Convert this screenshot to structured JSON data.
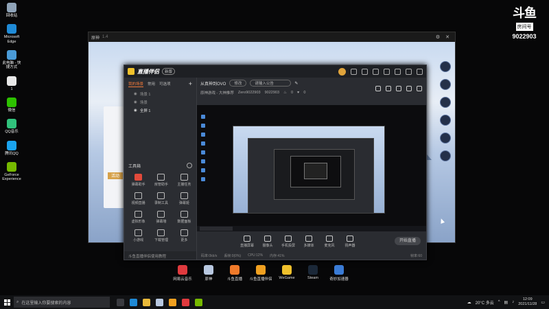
{
  "desktop_icons": [
    {
      "label": "回收站",
      "icon": "recycle-bin-icon",
      "color": "#8fa3b8"
    },
    {
      "label": "Microsoft Edge",
      "icon": "edge-icon",
      "color": "#1f8ad6"
    },
    {
      "label": "此电脑 - 快捷方式",
      "icon": "computer-icon",
      "color": "#4a9bd8"
    },
    {
      "label": "1",
      "icon": "file-icon",
      "color": "#e8e8e8"
    },
    {
      "label": "微信",
      "icon": "wechat-icon",
      "color": "#2dc100"
    },
    {
      "label": "QQ音乐",
      "icon": "qq-music-icon",
      "color": "#31c27c"
    },
    {
      "label": "腾讯QQ",
      "icon": "qq-icon",
      "color": "#1aa3ee"
    },
    {
      "label": "GeForce Experience",
      "icon": "geforce-icon",
      "color": "#76b900"
    }
  ],
  "watermark": {
    "logo": "斗鱼",
    "sub": "房间号",
    "room": "9022903"
  },
  "game_window": {
    "title": "原神",
    "version": "1.4"
  },
  "app": {
    "brand": "直播伴侣",
    "version_badge": "新版",
    "room_name": "从真神到OVO",
    "edit_label": "修改",
    "announce_placeholder": "请输入公告",
    "category": "原神游戏 - 大神推荐",
    "user": "Zero9022903",
    "room_id": "9022903",
    "fire_count": "0",
    "fans_count": "0",
    "tabs": [
      "我的场景",
      "常用",
      "可选项"
    ],
    "scenes": [
      "场景 1",
      "场景",
      "全屏 1"
    ],
    "tools_title": "工具箱",
    "tools": [
      {
        "label": "弹幕助手",
        "red": true
      },
      {
        "label": "房管助手",
        "red": false
      },
      {
        "label": "主播任务",
        "red": false
      },
      {
        "label": "视频直播",
        "red": false
      },
      {
        "label": "录制工具",
        "red": false
      },
      {
        "label": "弹幕姬",
        "red": false
      },
      {
        "label": "虚拟形象",
        "red": false
      },
      {
        "label": "弹幕墙",
        "red": false
      },
      {
        "label": "数据面板",
        "red": false
      },
      {
        "label": "小游戏",
        "red": false
      },
      {
        "label": "下载管理",
        "red": false
      },
      {
        "label": "更多",
        "red": false
      }
    ],
    "notice": "斗鱼直播伴侣使用教程",
    "bottom_tools": [
      {
        "label": "直播屏幕",
        "icon": "screen-icon"
      },
      {
        "label": "摄像头",
        "icon": "camera-icon"
      },
      {
        "label": "手机投屏",
        "icon": "phone-cast-icon"
      },
      {
        "label": "多媒体",
        "icon": "media-icon"
      },
      {
        "label": "麦克风",
        "icon": "microphone-icon"
      },
      {
        "label": "扬声器",
        "icon": "speaker-icon"
      }
    ],
    "start_button": "开始直播",
    "status": [
      "码率:0kb/s",
      "丢帧:0(0%)",
      "CPU:12%",
      "内存:41%"
    ],
    "status_end": "帧率:60"
  },
  "dock": [
    {
      "label": "网易云音乐",
      "color": "#e03a3e"
    },
    {
      "label": "原神",
      "color": "#b8c8e0"
    },
    {
      "label": "斗鱼直播",
      "color": "#f07a2a"
    },
    {
      "label": "斗鱼直播伴侣",
      "color": "#f0a020"
    },
    {
      "label": "WeGame",
      "color": "#f0c12c"
    },
    {
      "label": "Steam",
      "color": "#1b2838"
    },
    {
      "label": "奇妙加速器",
      "color": "#3a7bd5"
    }
  ],
  "taskbar": {
    "search_placeholder": "在这里输入你要搜索的内容",
    "weather": "20°C 多云",
    "time": "12:09",
    "date": "2021/11/28"
  }
}
